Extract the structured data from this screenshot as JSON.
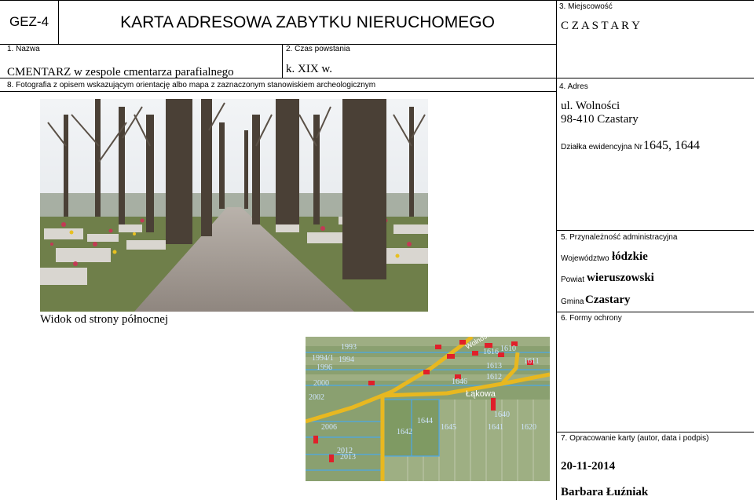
{
  "header": {
    "code": "GEZ-4",
    "title": "KARTA ADRESOWA ZABYTKU NIERUCHOMEGO"
  },
  "fields": {
    "f1_label": "1. Nazwa",
    "f1_value": "CMENTARZ w zespole cmentarza parafialnego",
    "f2_label": "2. Czas powstania",
    "f2_value": "k. XIX w.",
    "f3_label": "3. Miejscowość",
    "f3_value": "C Z A S T A R Y",
    "f4_label": "4. Adres",
    "f4_street": "ul. Wolności",
    "f4_city": "98-410 Czastary",
    "f4_parcel_label": "Działka ewidencyjna Nr",
    "f4_parcel_value": "1645, 1644",
    "f5_label": "5. Przynależność administracyjna",
    "f5_voiv_label": "Województwo",
    "f5_voiv_value": "łódzkie",
    "f5_county_label": "Powiat",
    "f5_county_value": "wieruszowski",
    "f5_commune_label": "Gmina",
    "f5_commune_value": "Czastary",
    "f6_label": "6. Formy ochrony",
    "f7_label": "7. Opracowanie karty (autor, data i podpis)",
    "f7_date": "20-11-2014",
    "f7_author": "Barbara Łuźniak",
    "f8_label": "8. Fotografia z opisem wskazującym orientację albo mapa z zaznaczonym stanowiskiem archeologicznym",
    "photo_caption": "Widok od strony północnej"
  },
  "map": {
    "labels": [
      "1993",
      "1994/1",
      "1994",
      "1996",
      "2000",
      "2002",
      "2006",
      "2012",
      "2013",
      "1642",
      "1644",
      "1645",
      "1646",
      "1616",
      "1613",
      "1612",
      "1610",
      "1611",
      "1640",
      "1641",
      "1620",
      "Łąkowa",
      "Wolności"
    ]
  },
  "colors": {
    "road": "#e8b820",
    "parcel": "#4aa8e8",
    "building": "#e0202a",
    "field_green": "#8aa070"
  }
}
